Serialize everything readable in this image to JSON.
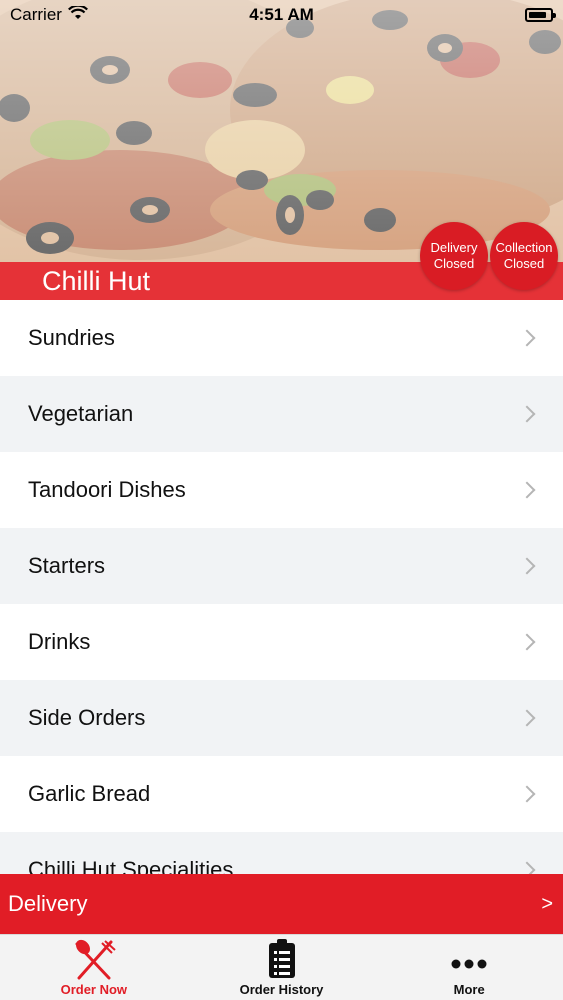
{
  "status_bar": {
    "carrier": "Carrier",
    "time": "4:51 AM",
    "battery_level": 0.85,
    "icons": [
      "wifi-icon",
      "battery-icon"
    ]
  },
  "header": {
    "restaurant_name": "Chilli Hut",
    "delivery_status": {
      "line1": "Delivery",
      "line2": "Closed"
    },
    "collection_status": {
      "line1": "Collection",
      "line2": "Closed"
    }
  },
  "categories": [
    {
      "label": "Sundries"
    },
    {
      "label": "Vegetarian"
    },
    {
      "label": "Tandoori Dishes"
    },
    {
      "label": "Starters"
    },
    {
      "label": "Drinks"
    },
    {
      "label": "Side Orders"
    },
    {
      "label": "Garlic Bread"
    },
    {
      "label": "Chilli Hut Specialities"
    }
  ],
  "delivery_bar": {
    "label": "Delivery",
    "arrow": ">"
  },
  "tabs": [
    {
      "label": "Order Now",
      "icon": "fork-knife-icon",
      "active": true
    },
    {
      "label": "Order History",
      "icon": "clipboard-list-icon",
      "active": false
    },
    {
      "label": "More",
      "icon": "more-dots-icon",
      "active": false
    }
  ],
  "colors": {
    "accent": "#e11d26",
    "status_circle": "#d91c24",
    "row_alt": "#f1f3f5",
    "chevron": "#b5b5b5"
  }
}
